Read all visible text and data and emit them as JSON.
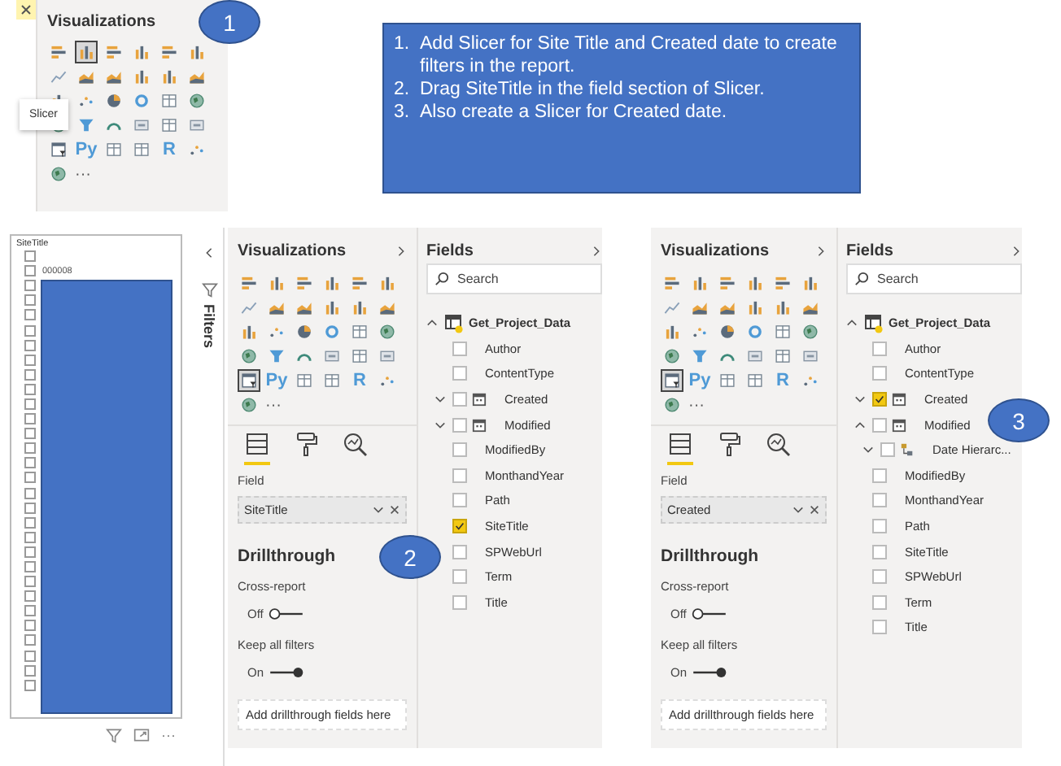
{
  "step_markers": [
    {
      "label": "1"
    },
    {
      "label": "2"
    },
    {
      "label": "3"
    }
  ],
  "top_panel": {
    "title": "Visualizations",
    "tooltip": "Slicer",
    "more": "···",
    "visuals": [
      {
        "kind": "stacked-bar",
        "selected": false
      },
      {
        "kind": "stacked-column",
        "selected": true
      },
      {
        "kind": "clustered-bar",
        "selected": false
      },
      {
        "kind": "clustered-column",
        "selected": false
      },
      {
        "kind": "stacked-bar-100",
        "selected": false
      },
      {
        "kind": "stacked-column-100",
        "selected": false
      },
      {
        "kind": "line",
        "selected": false
      },
      {
        "kind": "area",
        "selected": false
      },
      {
        "kind": "stacked-area",
        "selected": false
      },
      {
        "kind": "line-column",
        "selected": false
      },
      {
        "kind": "line-column2",
        "selected": false
      },
      {
        "kind": "ribbon",
        "selected": false
      },
      {
        "kind": "waterfall",
        "selected": false
      },
      {
        "kind": "scatter",
        "selected": false
      },
      {
        "kind": "pie",
        "selected": false
      },
      {
        "kind": "donut",
        "selected": false
      },
      {
        "kind": "treemap",
        "selected": false
      },
      {
        "kind": "map",
        "selected": false
      },
      {
        "kind": "filled-map",
        "selected": false
      },
      {
        "kind": "funnel",
        "selected": false
      },
      {
        "kind": "gauge",
        "selected": false
      },
      {
        "kind": "card",
        "selected": false
      },
      {
        "kind": "multirow-card",
        "selected": false
      },
      {
        "kind": "kpi",
        "selected": false
      },
      {
        "kind": "slicer",
        "selected": false
      },
      {
        "kind": "python",
        "label": "Py",
        "selected": false
      },
      {
        "kind": "table",
        "selected": false
      },
      {
        "kind": "matrix",
        "selected": false
      },
      {
        "kind": "r",
        "label": "R",
        "selected": false
      },
      {
        "kind": "key-influencers",
        "selected": false
      },
      {
        "kind": "globe",
        "selected": false
      }
    ]
  },
  "instructions": [
    {
      "number": "1.",
      "text": "Add Slicer for Site Title and Created date to create filters in the report."
    },
    {
      "number": "2.",
      "text": "Drag SiteTitle in the field section of Slicer."
    },
    {
      "number": "3.",
      "text": "Also create a Slicer for Created date."
    }
  ],
  "slicer": {
    "header": "SiteTitle",
    "more": "···",
    "items": [
      {
        "checked": false
      },
      {
        "label": "000008",
        "checked": false
      },
      {
        "checked": false
      },
      {
        "checked": false
      },
      {
        "checked": false
      },
      {
        "checked": false
      },
      {
        "checked": false
      },
      {
        "checked": false
      },
      {
        "checked": false
      },
      {
        "checked": false
      },
      {
        "checked": false
      },
      {
        "checked": false
      },
      {
        "checked": false
      },
      {
        "checked": false
      },
      {
        "checked": false
      },
      {
        "checked": false
      },
      {
        "checked": false
      },
      {
        "checked": false
      },
      {
        "checked": false
      },
      {
        "checked": false
      },
      {
        "checked": false
      },
      {
        "checked": false
      },
      {
        "checked": false
      },
      {
        "checked": false
      },
      {
        "checked": false
      },
      {
        "checked": false
      },
      {
        "checked": false
      },
      {
        "checked": false
      },
      {
        "checked": false
      },
      {
        "checked": false
      }
    ]
  },
  "filters_pane": {
    "label": "Filters"
  },
  "panels": [
    {
      "viz_title": "Visualizations",
      "more": "···",
      "visuals": [
        {
          "kind": "stacked-bar",
          "selected": false
        },
        {
          "kind": "stacked-column",
          "selected": false
        },
        {
          "kind": "clustered-bar",
          "selected": false
        },
        {
          "kind": "clustered-column",
          "selected": false
        },
        {
          "kind": "stacked-bar-100",
          "selected": false
        },
        {
          "kind": "stacked-column-100",
          "selected": false
        },
        {
          "kind": "line",
          "selected": false
        },
        {
          "kind": "area",
          "selected": false
        },
        {
          "kind": "stacked-area",
          "selected": false
        },
        {
          "kind": "line-column",
          "selected": false
        },
        {
          "kind": "line-column2",
          "selected": false
        },
        {
          "kind": "ribbon",
          "selected": false
        },
        {
          "kind": "waterfall",
          "selected": false
        },
        {
          "kind": "scatter",
          "selected": false
        },
        {
          "kind": "pie",
          "selected": false
        },
        {
          "kind": "donut",
          "selected": false
        },
        {
          "kind": "treemap",
          "selected": false
        },
        {
          "kind": "map",
          "selected": false
        },
        {
          "kind": "filled-map",
          "selected": false
        },
        {
          "kind": "funnel",
          "selected": false
        },
        {
          "kind": "gauge",
          "selected": false
        },
        {
          "kind": "card",
          "selected": false
        },
        {
          "kind": "multirow-card",
          "selected": false
        },
        {
          "kind": "kpi",
          "selected": false
        },
        {
          "kind": "slicer",
          "selected": true
        },
        {
          "kind": "python",
          "label": "Py",
          "selected": false
        },
        {
          "kind": "table",
          "selected": false
        },
        {
          "kind": "matrix",
          "selected": false
        },
        {
          "kind": "r",
          "label": "R",
          "selected": false
        },
        {
          "kind": "key-influencers",
          "selected": false
        },
        {
          "kind": "globe",
          "selected": false
        }
      ],
      "field_label": "Field",
      "field_value": "SiteTitle",
      "drillthrough": "Drillthrough",
      "cross_report": "Cross-report",
      "cross_state": "Off",
      "cross_on": false,
      "keep_filters": "Keep all filters",
      "keep_state": "On",
      "keep_on": true,
      "drop_hint": "Add drillthrough fields here",
      "fields_title": "Fields",
      "search_placeholder": "Search",
      "table": {
        "name": "Get_Project_Data",
        "expanded": true
      },
      "fields": [
        {
          "name": "Author",
          "kind": "column",
          "checked": false
        },
        {
          "name": "ContentType",
          "kind": "column",
          "checked": false
        },
        {
          "name": "Created",
          "kind": "date",
          "checked": false,
          "expanded": false
        },
        {
          "name": "Modified",
          "kind": "date",
          "checked": false,
          "expanded": false
        },
        {
          "name": "ModifiedBy",
          "kind": "column",
          "checked": false
        },
        {
          "name": "MonthandYear",
          "kind": "column",
          "checked": false
        },
        {
          "name": "Path",
          "kind": "column",
          "checked": false
        },
        {
          "name": "SiteTitle",
          "kind": "column",
          "checked": true
        },
        {
          "name": "SPWebUrl",
          "kind": "column",
          "checked": false
        },
        {
          "name": "Term",
          "kind": "column",
          "checked": false
        },
        {
          "name": "Title",
          "kind": "column",
          "checked": false
        }
      ]
    },
    {
      "viz_title": "Visualizations",
      "more": "···",
      "visuals": [
        {
          "kind": "stacked-bar",
          "selected": false
        },
        {
          "kind": "stacked-column",
          "selected": false
        },
        {
          "kind": "clustered-bar",
          "selected": false
        },
        {
          "kind": "clustered-column",
          "selected": false
        },
        {
          "kind": "stacked-bar-100",
          "selected": false
        },
        {
          "kind": "stacked-column-100",
          "selected": false
        },
        {
          "kind": "line",
          "selected": false
        },
        {
          "kind": "area",
          "selected": false
        },
        {
          "kind": "stacked-area",
          "selected": false
        },
        {
          "kind": "line-column",
          "selected": false
        },
        {
          "kind": "line-column2",
          "selected": false
        },
        {
          "kind": "ribbon",
          "selected": false
        },
        {
          "kind": "waterfall",
          "selected": false
        },
        {
          "kind": "scatter",
          "selected": false
        },
        {
          "kind": "pie",
          "selected": false
        },
        {
          "kind": "donut",
          "selected": false
        },
        {
          "kind": "treemap",
          "selected": false
        },
        {
          "kind": "map",
          "selected": false
        },
        {
          "kind": "filled-map",
          "selected": false
        },
        {
          "kind": "funnel",
          "selected": false
        },
        {
          "kind": "gauge",
          "selected": false
        },
        {
          "kind": "card",
          "selected": false
        },
        {
          "kind": "multirow-card",
          "selected": false
        },
        {
          "kind": "kpi",
          "selected": false
        },
        {
          "kind": "slicer",
          "selected": true
        },
        {
          "kind": "python",
          "label": "Py",
          "selected": false
        },
        {
          "kind": "table",
          "selected": false
        },
        {
          "kind": "matrix",
          "selected": false
        },
        {
          "kind": "r",
          "label": "R",
          "selected": false
        },
        {
          "kind": "key-influencers",
          "selected": false
        },
        {
          "kind": "globe",
          "selected": false
        }
      ],
      "field_label": "Field",
      "field_value": "Created",
      "drillthrough": "Drillthrough",
      "cross_report": "Cross-report",
      "cross_state": "Off",
      "cross_on": false,
      "keep_filters": "Keep all filters",
      "keep_state": "On",
      "keep_on": true,
      "drop_hint": "Add drillthrough fields here",
      "fields_title": "Fields",
      "search_placeholder": "Search",
      "table": {
        "name": "Get_Project_Data",
        "expanded": true
      },
      "fields": [
        {
          "name": "Author",
          "kind": "column",
          "checked": false
        },
        {
          "name": "ContentType",
          "kind": "column",
          "checked": false
        },
        {
          "name": "Created",
          "kind": "date",
          "checked": true,
          "expanded": false
        },
        {
          "name": "Modified",
          "kind": "date",
          "checked": false,
          "expanded": true,
          "children": [
            {
              "name": "Date Hierarc...",
              "kind": "hierarchy",
              "checked": false,
              "expanded": false
            }
          ]
        },
        {
          "name": "ModifiedBy",
          "kind": "column",
          "checked": false
        },
        {
          "name": "MonthandYear",
          "kind": "column",
          "checked": false
        },
        {
          "name": "Path",
          "kind": "column",
          "checked": false
        },
        {
          "name": "SiteTitle",
          "kind": "column",
          "checked": false
        },
        {
          "name": "SPWebUrl",
          "kind": "column",
          "checked": false
        },
        {
          "name": "Term",
          "kind": "column",
          "checked": false
        },
        {
          "name": "Title",
          "kind": "column",
          "checked": false
        }
      ]
    }
  ]
}
